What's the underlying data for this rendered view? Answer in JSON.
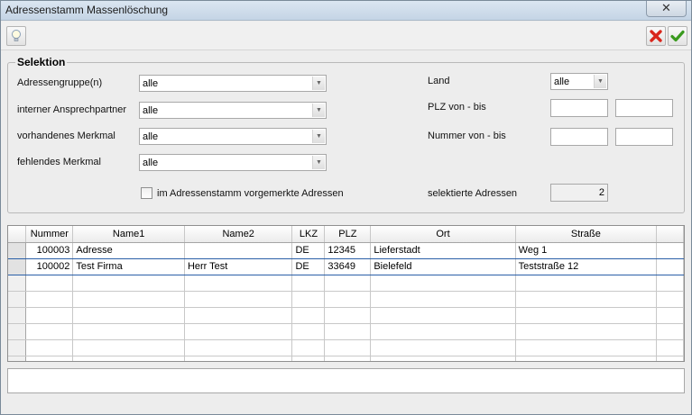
{
  "window": {
    "title": "Adressenstamm Massenlöschung",
    "close_label": "✕"
  },
  "toolbar": {
    "hint_icon": "lightbulb-icon",
    "cancel_icon": "red-x-icon",
    "ok_icon": "green-check-icon"
  },
  "selection": {
    "legend": "Selektion",
    "left": [
      {
        "label": "Adressengruppe(n)",
        "value": "alle"
      },
      {
        "label": "interner Ansprechpartner",
        "value": "alle"
      },
      {
        "label": "vorhandenes Merkmal",
        "value": "alle"
      },
      {
        "label": "fehlendes Merkmal",
        "value": "alle"
      }
    ],
    "checkbox_label": "im Adressenstamm vorgemerkte Adressen",
    "checkbox_checked": false,
    "land_label": "Land",
    "land_value": "alle",
    "plz_label": "PLZ von - bis",
    "plz_from": "",
    "plz_to": "",
    "nummer_label": "Nummer von - bis",
    "nummer_from": "",
    "nummer_to": "",
    "selected_label": "selektierte Adressen",
    "selected_count": "2"
  },
  "grid": {
    "columns": [
      "Nummer",
      "Name1",
      "Name2",
      "LKZ",
      "PLZ",
      "Ort",
      "Straße"
    ],
    "rows": [
      [
        "100003",
        "Adresse",
        "",
        "DE",
        "12345",
        "Lieferstadt",
        "Weg 1"
      ],
      [
        "100002",
        "Test Firma",
        "Herr Test",
        "DE",
        "33649",
        "Bielefeld",
        "Teststraße 12"
      ]
    ]
  },
  "status": {
    "text": ""
  }
}
